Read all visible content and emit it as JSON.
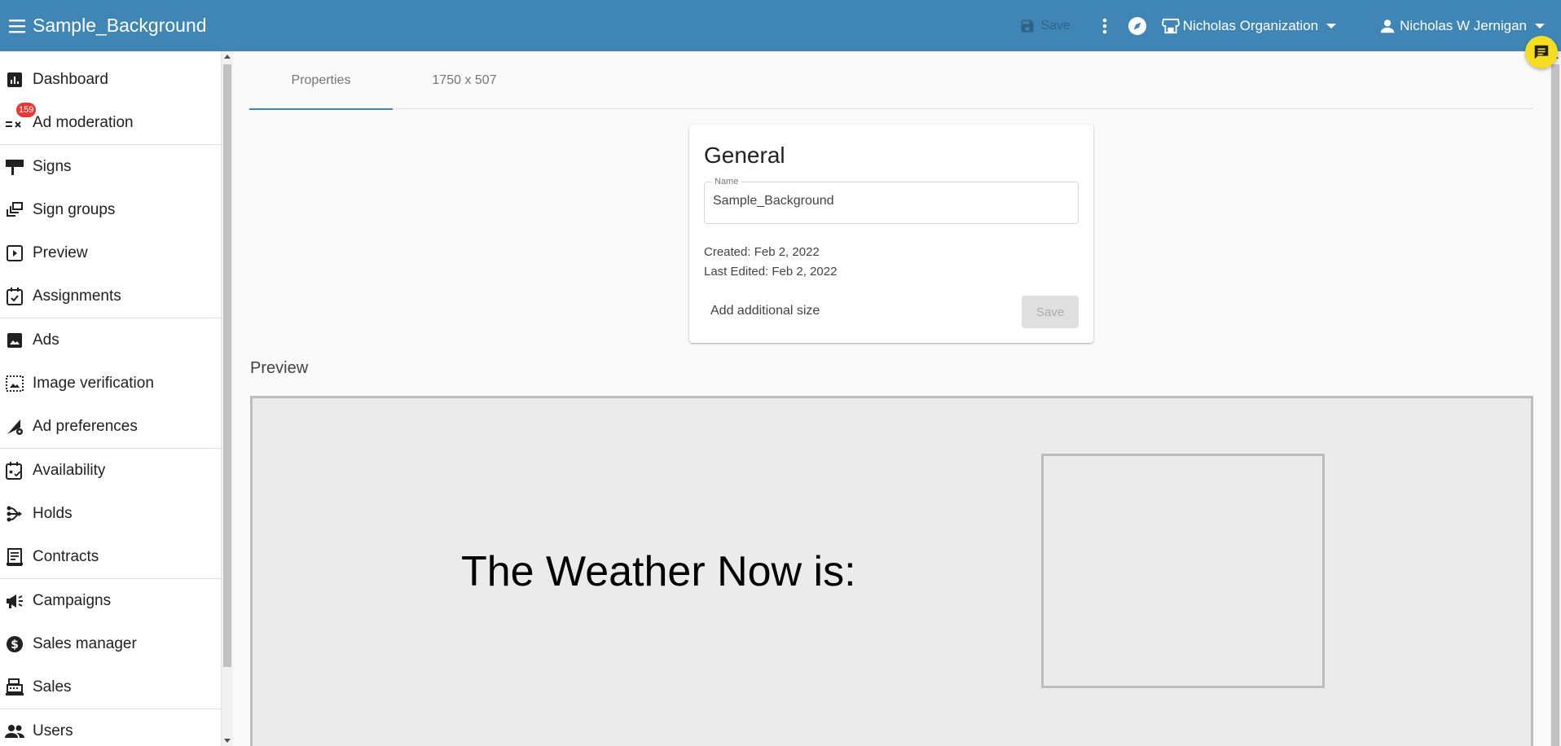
{
  "header": {
    "title": "Sample_Background",
    "save_label": "Save",
    "organization": "Nicholas Organization",
    "user": "Nicholas W Jernigan"
  },
  "sidebar": {
    "items": [
      {
        "label": "Dashboard",
        "icon": "dashboard-icon"
      },
      {
        "label": "Ad moderation",
        "icon": "ad-moderation-icon",
        "badge": "159"
      },
      {
        "label": "Signs",
        "icon": "sign-icon"
      },
      {
        "label": "Sign groups",
        "icon": "sign-groups-icon"
      },
      {
        "label": "Preview",
        "icon": "preview-icon"
      },
      {
        "label": "Assignments",
        "icon": "calendar-check-icon"
      },
      {
        "label": "Ads",
        "icon": "image-icon"
      },
      {
        "label": "Image verification",
        "icon": "image-verification-icon"
      },
      {
        "label": "Ad preferences",
        "icon": "ad-preferences-icon"
      },
      {
        "label": "Availability",
        "icon": "availability-icon"
      },
      {
        "label": "Holds",
        "icon": "holds-icon"
      },
      {
        "label": "Contracts",
        "icon": "contracts-icon"
      },
      {
        "label": "Campaigns",
        "icon": "campaigns-icon"
      },
      {
        "label": "Sales manager",
        "icon": "dollar-icon"
      },
      {
        "label": "Sales",
        "icon": "register-icon"
      },
      {
        "label": "Users",
        "icon": "users-icon"
      }
    ]
  },
  "tabs": [
    {
      "label": "Properties"
    },
    {
      "label": "1750 x 507"
    }
  ],
  "general": {
    "title": "General",
    "name_label": "Name",
    "name_value": "Sample_Background",
    "created": "Created: Feb 2, 2022",
    "last_edited": "Last Edited: Feb 2, 2022",
    "add_size": "Add additional size",
    "save_label": "Save"
  },
  "preview": {
    "label": "Preview",
    "weather_text": "The Weather Now is:"
  },
  "colors": {
    "topbar": "#3f86b7",
    "badge": "#e53935",
    "chat_fab": "#f5dd1f"
  }
}
